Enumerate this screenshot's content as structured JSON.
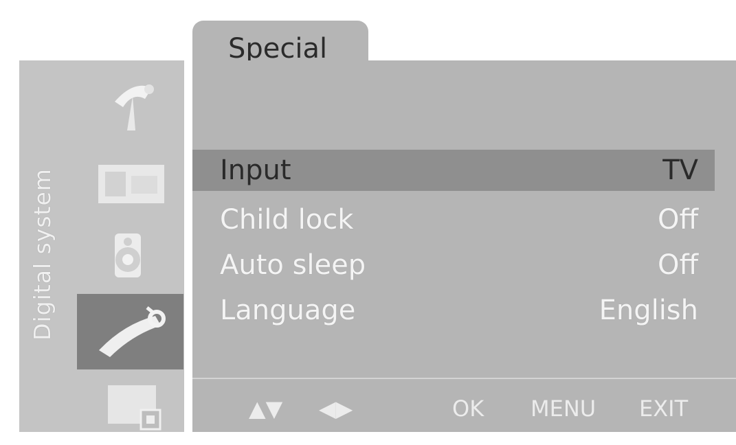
{
  "sidebar": {
    "brand": "Digital system",
    "icons": [
      {
        "name": "antenna-icon"
      },
      {
        "name": "picture-icon"
      },
      {
        "name": "sound-icon"
      },
      {
        "name": "special-icon",
        "selected": true
      },
      {
        "name": "screen-icon"
      }
    ]
  },
  "tab": {
    "label": "Special"
  },
  "menu": {
    "items": [
      {
        "label": "Input",
        "value": "TV"
      },
      {
        "label": "Child lock",
        "value": "Off"
      },
      {
        "label": "Auto sleep",
        "value": "Off"
      },
      {
        "label": "Language",
        "value": "English"
      }
    ]
  },
  "footer": {
    "nav_updown": "▲▼",
    "nav_leftright": "◀▶",
    "ok": "OK",
    "menu": "MENU",
    "exit": "EXIT"
  }
}
